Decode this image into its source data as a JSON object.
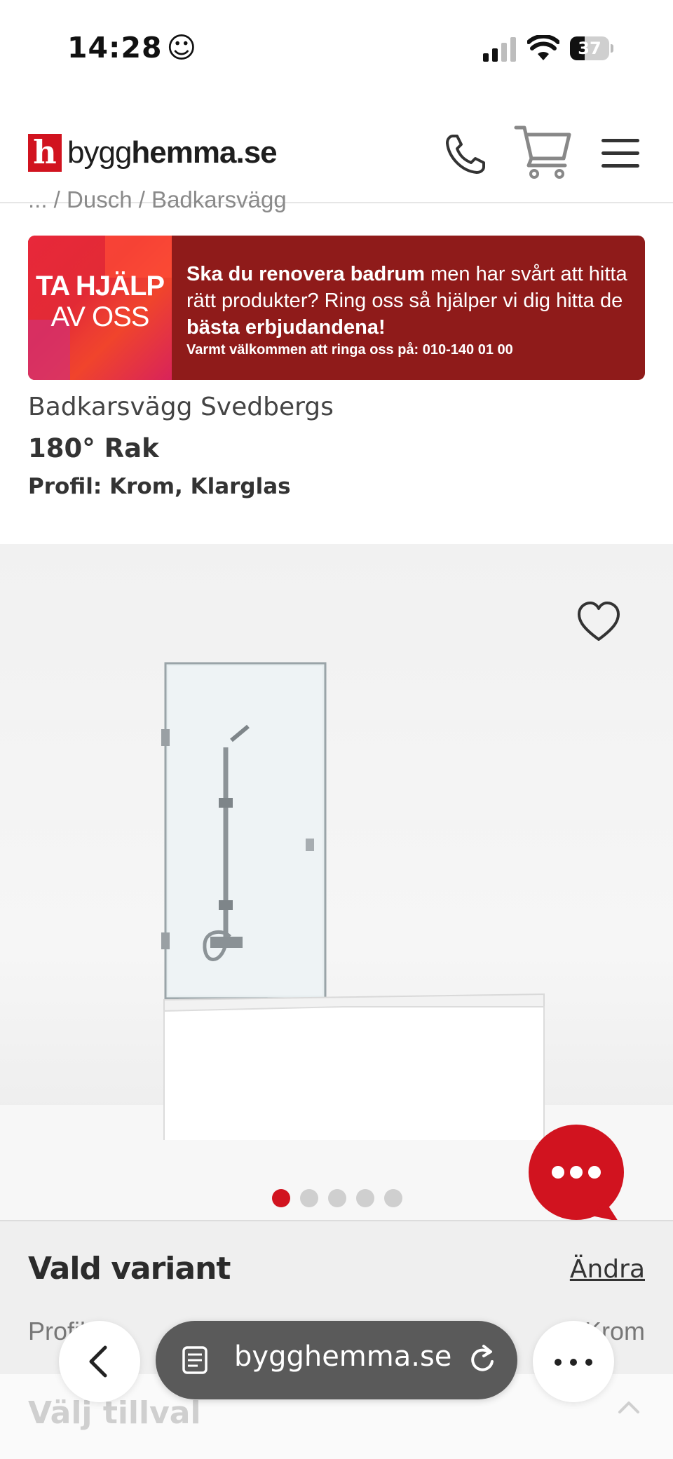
{
  "status_bar": {
    "time": "14:28",
    "emoji": "☺",
    "battery": "37",
    "battery_level": 0.37
  },
  "header": {
    "logo_mark": "h",
    "logo_text_regular": "bygg",
    "logo_text_bold": "hemma.se",
    "icons": [
      "phone-icon",
      "cart-icon",
      "menu-icon"
    ]
  },
  "breadcrumb": "... / Dusch / Badkarsvägg",
  "promo": {
    "left_line1": "TA HJÄLP",
    "left_line2": "AV OSS",
    "text_bold1": "Ska du renovera badrum",
    "text_regular": " men har svårt att hitta rätt produkter? Ring oss så hjälper vi dig hitta de ",
    "text_bold2": "bästa erbjudandena!",
    "small": "Varmt välkommen att ringa oss på: 010-140 01 00"
  },
  "product": {
    "brand": "Badkarsvägg Svedbergs",
    "title": "180° Rak",
    "profile": "Profil: Krom, Klarglas"
  },
  "gallery": {
    "image_count": 5,
    "active_index": 0,
    "favorite_icon": "heart-icon",
    "chat_icon": "chat-bubble-icon"
  },
  "variant": {
    "title": "Vald variant",
    "change": "Ändra",
    "profile_label": "Profil",
    "profile_value": "Krom",
    "addons_title": "Välj tillval"
  },
  "browser": {
    "url": "bygghemma.se",
    "back_icon": "chevron-left-icon",
    "reader_icon": "reader-icon",
    "reload_icon": "reload-icon",
    "more_icon": "more-icon"
  },
  "colors": {
    "brand_red": "#d1131f",
    "promo_dark_red": "#8f1b1a"
  }
}
